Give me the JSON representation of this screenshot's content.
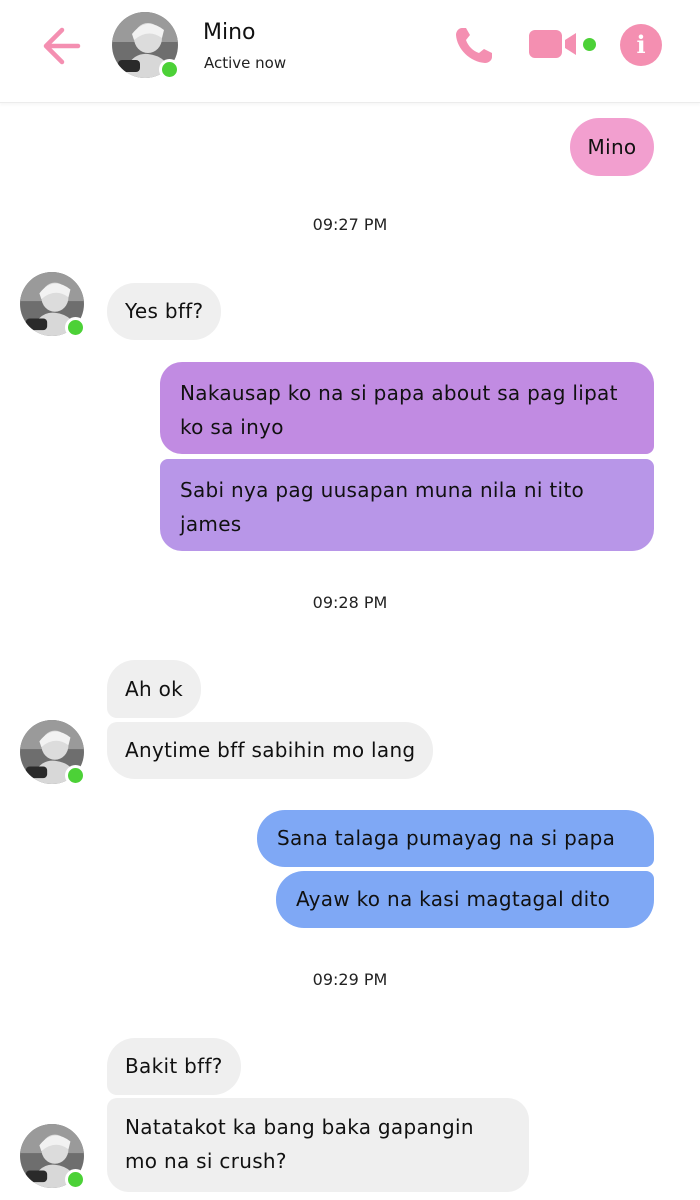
{
  "header": {
    "contact_name": "Mino",
    "status": "Active now",
    "icons": {
      "back": "back-arrow-icon",
      "call": "phone-icon",
      "video": "video-camera-icon",
      "info": "info-icon"
    },
    "info_glyph": "i"
  },
  "colors": {
    "accent": "#f48fb1",
    "online": "#4cd137",
    "bubble_incoming": "#efefef",
    "bubble_pink": "#f29fcf",
    "bubble_purple": "#c18be2",
    "bubble_blue": "#7fa8f5"
  },
  "conversation": {
    "msg_mino": "Mino",
    "time_1": "09:27 PM",
    "msg_yes_bff": "Yes bff?",
    "msg_nakausap": "Nakausap ko na si papa about sa pag lipat ko sa inyo",
    "msg_sabi_nya": "Sabi nya pag uusapan muna nila ni tito james",
    "time_2": "09:28 PM",
    "msg_ah_ok": "Ah ok",
    "msg_anytime": "Anytime bff sabihin mo lang",
    "msg_sana": "Sana talaga pumayag na si papa",
    "msg_ayaw": "Ayaw ko na kasi magtagal dito",
    "time_3": "09:29 PM",
    "msg_bakit": "Bakit bff?",
    "msg_natatakot": "Natatakot ka bang baka gapangin mo na si crush?"
  }
}
